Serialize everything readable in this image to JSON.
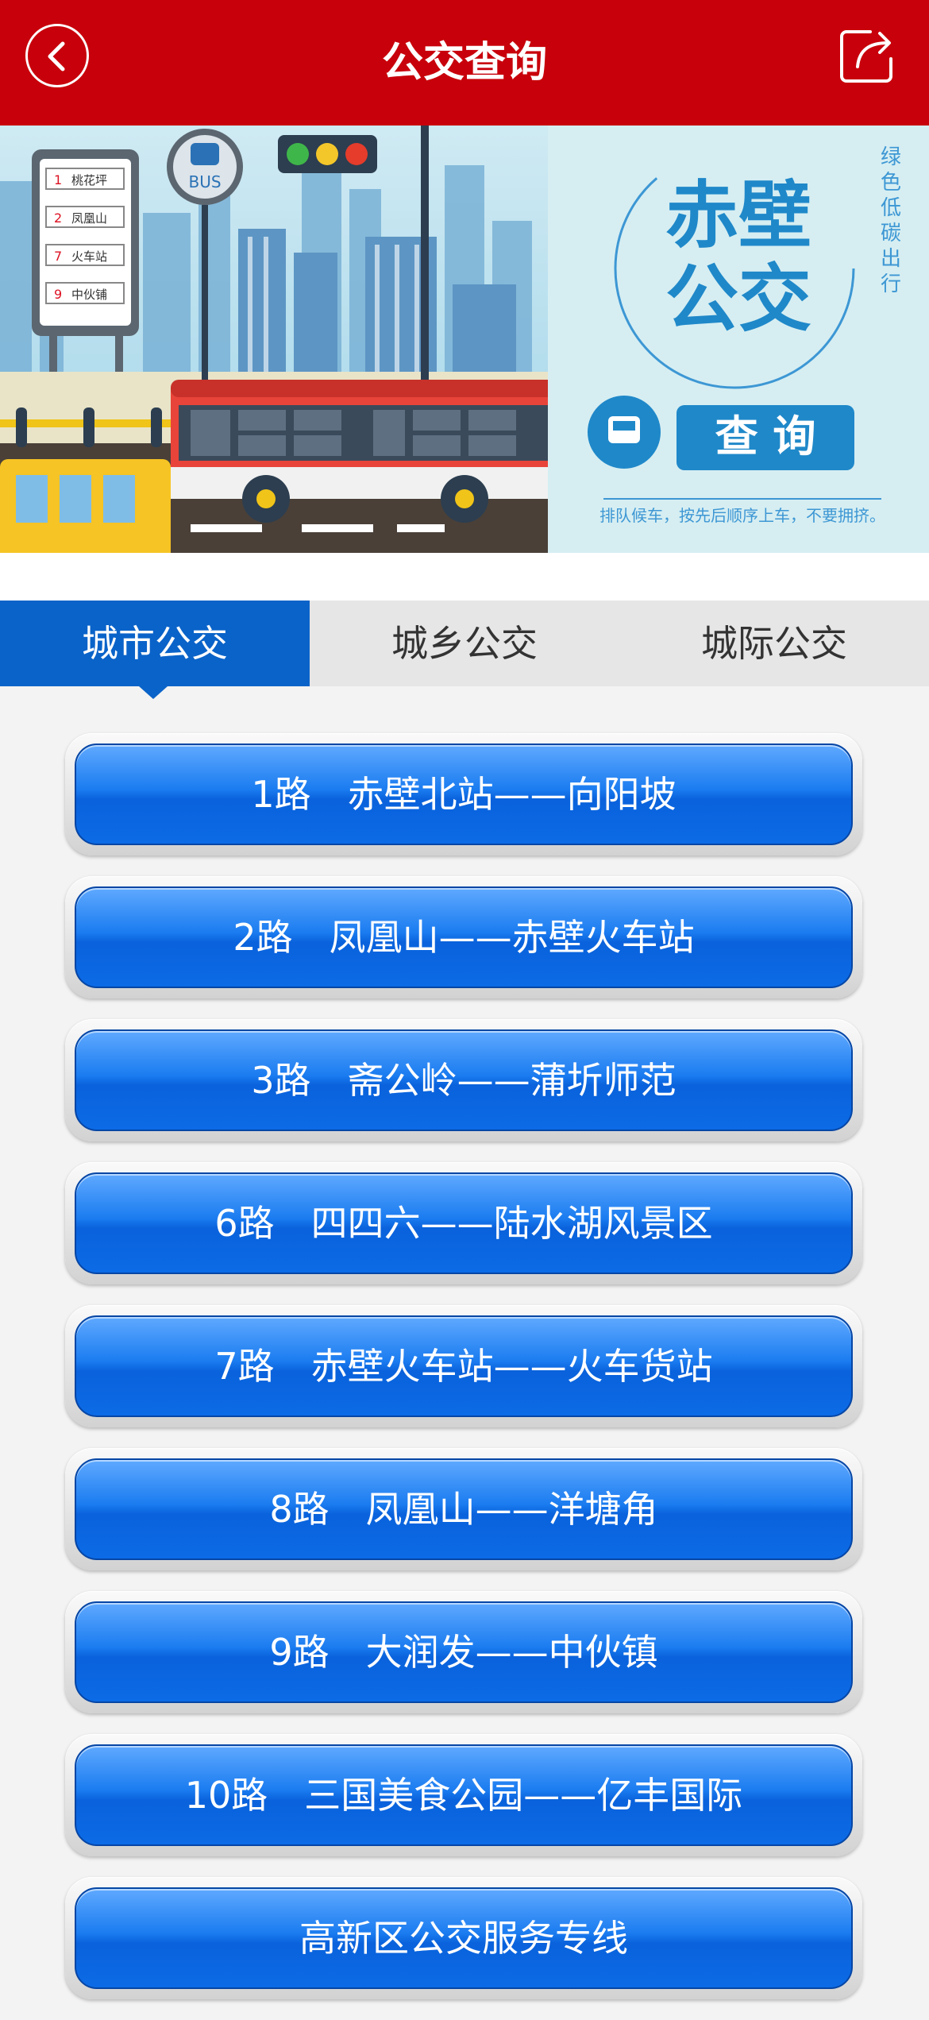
{
  "header": {
    "title": "公交查询"
  },
  "banner": {
    "brand_line1": "赤壁",
    "brand_line2": "公交",
    "slogan_vertical": "绿色低碳出行",
    "query_label": "查 询",
    "notice": "排队候车，按先后顺序上车，不要拥挤。",
    "bus_sign": "BUS",
    "stops": [
      {
        "num": "1",
        "name": "桃花坪"
      },
      {
        "num": "2",
        "name": "凤凰山"
      },
      {
        "num": "7",
        "name": "火车站"
      },
      {
        "num": "9",
        "name": "中伙铺"
      }
    ]
  },
  "tabs": [
    {
      "label": "城市公交",
      "active": true
    },
    {
      "label": "城乡公交",
      "active": false
    },
    {
      "label": "城际公交",
      "active": false
    }
  ],
  "routes": [
    "1路　赤壁北站——向阳坡",
    "2路　凤凰山——赤壁火车站",
    "3路　斋公岭——蒲圻师范",
    "6路　四四六——陆水湖风景区",
    "7路　赤壁火车站——火车货站",
    "8路　凤凰山——洋塘角",
    "9路　大润发——中伙镇",
    "10路　三国美食公园——亿丰国际",
    "高新区公交服务专线"
  ],
  "colors": {
    "header": "#c8000b",
    "tab_active": "#0a63c9",
    "button": "#0a62dc"
  }
}
